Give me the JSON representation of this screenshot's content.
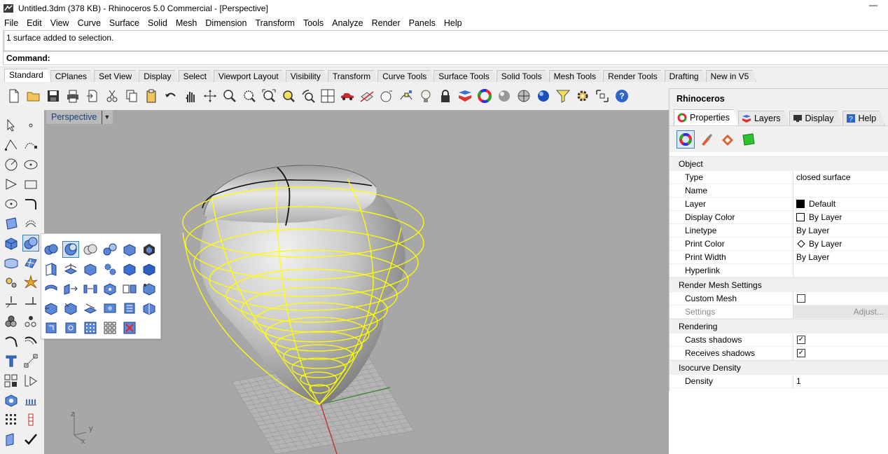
{
  "window": {
    "title": "Untitled.3dm (378 KB) - Rhinoceros 5.0 Commercial - [Perspective]",
    "minimize": "—"
  },
  "menu": [
    "File",
    "Edit",
    "View",
    "Curve",
    "Surface",
    "Solid",
    "Mesh",
    "Dimension",
    "Transform",
    "Tools",
    "Analyze",
    "Render",
    "Panels",
    "Help"
  ],
  "history": {
    "line": "1 surface added to selection."
  },
  "command": {
    "label": "Command:",
    "value": ""
  },
  "toolbar_tabs": [
    "Standard",
    "CPlanes",
    "Set View",
    "Display",
    "Select",
    "Viewport Layout",
    "Visibility",
    "Transform",
    "Curve Tools",
    "Surface Tools",
    "Solid Tools",
    "Mesh Tools",
    "Render Tools",
    "Drafting",
    "New in V5"
  ],
  "active_tab": "Standard",
  "toolbar_icons": [
    "new-icon",
    "open-icon",
    "save-icon",
    "print-icon",
    "import-icon",
    "cut-icon",
    "copy-icon",
    "paste-icon",
    "undo-icon",
    "pan-icon",
    "rotate-icon",
    "zoom-icon",
    "zoom-window-icon",
    "zoom-extents-icon",
    "zoom-selected-icon",
    "rotate-view-icon",
    "four-view-icon",
    "car-icon",
    "hide-icon",
    "show-icon",
    "point-edit-icon",
    "light-icon",
    "lock-icon",
    "layer-icon",
    "color-wheel-icon",
    "material-icon",
    "sphere-render-icon",
    "render-icon",
    "filter-icon",
    "options-icon",
    "snapshot-icon",
    "help-icon"
  ],
  "viewport": {
    "label": "Perspective",
    "axes": {
      "z": "z",
      "y": "y",
      "x": "x"
    }
  },
  "panel": {
    "title": "Rhinoceros",
    "tabs": [
      "Properties",
      "Layers",
      "Display",
      "Help"
    ],
    "active_tab": "Properties",
    "sections": {
      "object": "Object",
      "render_mesh": "Render Mesh Settings",
      "rendering": "Rendering",
      "isocurve": "Isocurve Density"
    },
    "object_rows": [
      {
        "k": "Type",
        "v": "closed surface"
      },
      {
        "k": "Name",
        "v": ""
      },
      {
        "k": "Layer",
        "v": "Default"
      },
      {
        "k": "Display Color",
        "v": "By Layer"
      },
      {
        "k": "Linetype",
        "v": "By Layer"
      },
      {
        "k": "Print Color",
        "v": "By Layer"
      },
      {
        "k": "Print Width",
        "v": "By Layer"
      },
      {
        "k": "Hyperlink",
        "v": ""
      }
    ],
    "mesh_rows": [
      {
        "k": "Custom Mesh",
        "checked": false
      },
      {
        "k": "Settings",
        "v": "Adjust..."
      }
    ],
    "rendering_rows": [
      {
        "k": "Casts shadows",
        "checked": true
      },
      {
        "k": "Receives shadows",
        "checked": true
      }
    ],
    "isocurve_rows": [
      {
        "k": "Density",
        "v": "1"
      }
    ]
  },
  "colors": {
    "viewport_bg": "#a7a7a7",
    "selection": "#ffff00",
    "accent": "#3c7fb1"
  }
}
